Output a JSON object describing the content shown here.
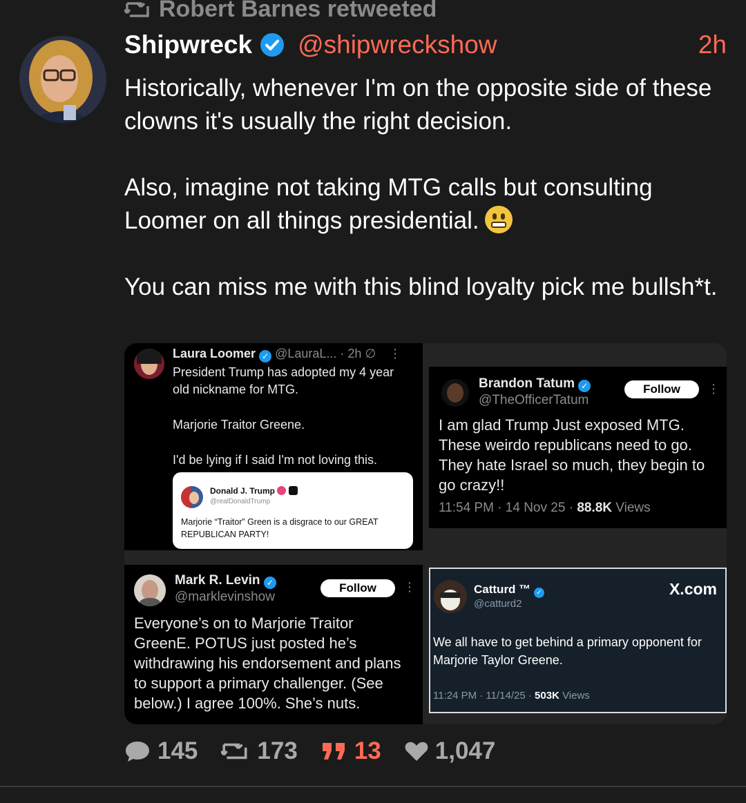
{
  "retweet": {
    "text": "Robert Barnes retweeted"
  },
  "tweet": {
    "display_name": "Shipwreck",
    "handle": "@shipwreckshow",
    "time": "2h",
    "paragraphs": [
      "Historically, whenever I'm on the opposite side of these clowns it's usually the right decision.",
      "Also, imagine not taking MTG calls but consulting Loomer on all things presidential.",
      "You can miss me with this blind loyalty pick me bullsh*t."
    ]
  },
  "cards": {
    "loomer": {
      "name": "Laura Loomer",
      "handle": "@LauraL...",
      "time": "· 2h",
      "lines": [
        "President Trump has adopted my 4 year old nickname for MTG.",
        "Marjorie Traitor Greene.",
        "I'd be lying if I said I'm not loving this."
      ],
      "quote": {
        "name": "Donald J. Trump",
        "handle": "@realDonaldTrump",
        "text": "Marjorie “Traitor” Green is a disgrace to our GREAT REPUBLICAN PARTY!"
      }
    },
    "tatum": {
      "name": "Brandon Tatum",
      "handle": "@TheOfficerTatum",
      "follow": "Follow",
      "text": "I am glad Trump Just exposed MTG. These weirdo republicans need to go. They hate Israel so much, they begin to go crazy!!",
      "meta": "11:54 PM · 14 Nov 25 ·",
      "views_count": "88.8K",
      "views_label": "Views"
    },
    "levin": {
      "name": "Mark R. Levin",
      "handle": "@marklevinshow",
      "follow": "Follow",
      "text": "Everyone’s on to Marjorie Traitor GreenE. POTUS just posted he’s withdrawing his endorsement and plans to support a primary challenger. (See below.) I agree 100%. She’s nuts."
    },
    "catturd": {
      "name": "Catturd ™",
      "handle": "@catturd2",
      "brand": "X.com",
      "text": "We all have to get behind a primary opponent for Marjorie Taylor Greene.",
      "meta": "11:24 PM · 11/14/25 ·",
      "views_count": "503K",
      "views_label": "Views"
    }
  },
  "stats": {
    "replies": "145",
    "retweets": "173",
    "quotes": "13",
    "likes": "1,047"
  },
  "colors": {
    "accent": "#ff6a55",
    "verified": "#1d9bf0",
    "background": "#1b1b1b"
  }
}
